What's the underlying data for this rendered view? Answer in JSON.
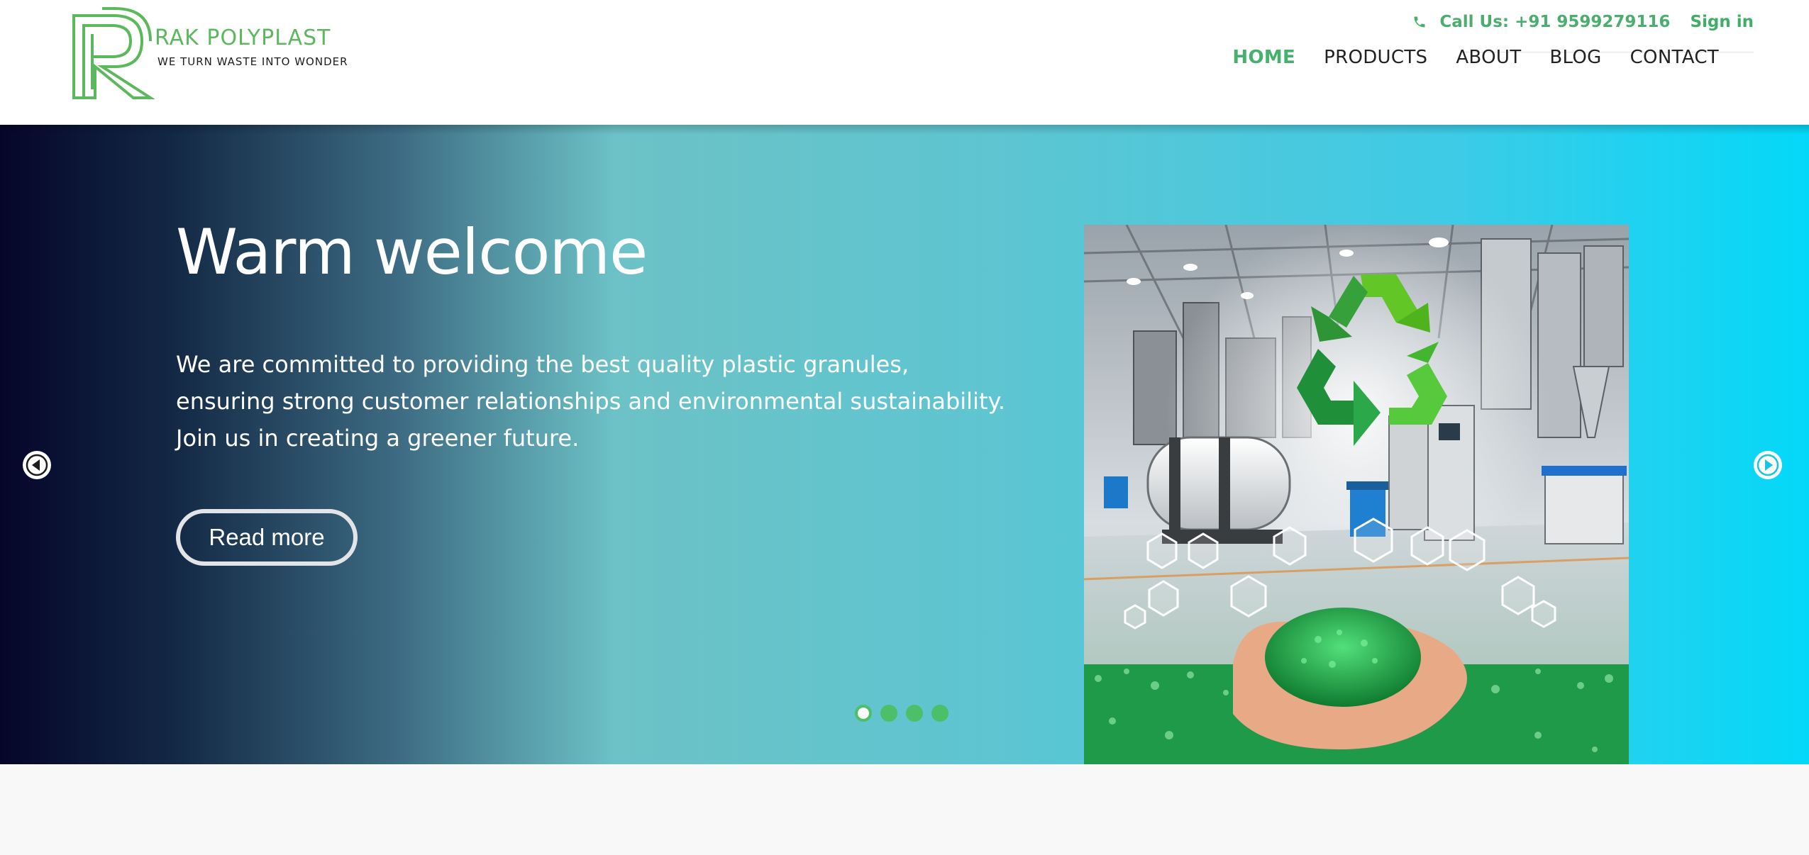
{
  "brand": {
    "name": "RAK POLYPLAST",
    "tagline": "WE TURN WASTE INTO WONDER"
  },
  "topbar": {
    "call_label": "Call Us: +91 9599279116",
    "signin_label": "Sign in",
    "icon": "phone-icon"
  },
  "nav": {
    "items": [
      {
        "label": "HOME",
        "active": true
      },
      {
        "label": "PRODUCTS",
        "active": false
      },
      {
        "label": "ABOUT",
        "active": false
      },
      {
        "label": "BLOG",
        "active": false
      },
      {
        "label": "CONTACT",
        "active": false
      }
    ]
  },
  "hero": {
    "title": "Warm welcome",
    "text": "We are committed to providing the best quality plastic granules, ensuring strong customer relationships and environmental sustainability. Join us in creating a greener future.",
    "button_label": "Read more",
    "slides_count": 4,
    "active_slide": 1,
    "image_alt": "recycling-plant-illustration"
  },
  "colors": {
    "accent": "#46b06d",
    "brand_green": "#5cb85c",
    "hero_start": "#05052a",
    "hero_end": "#04d8f8"
  }
}
